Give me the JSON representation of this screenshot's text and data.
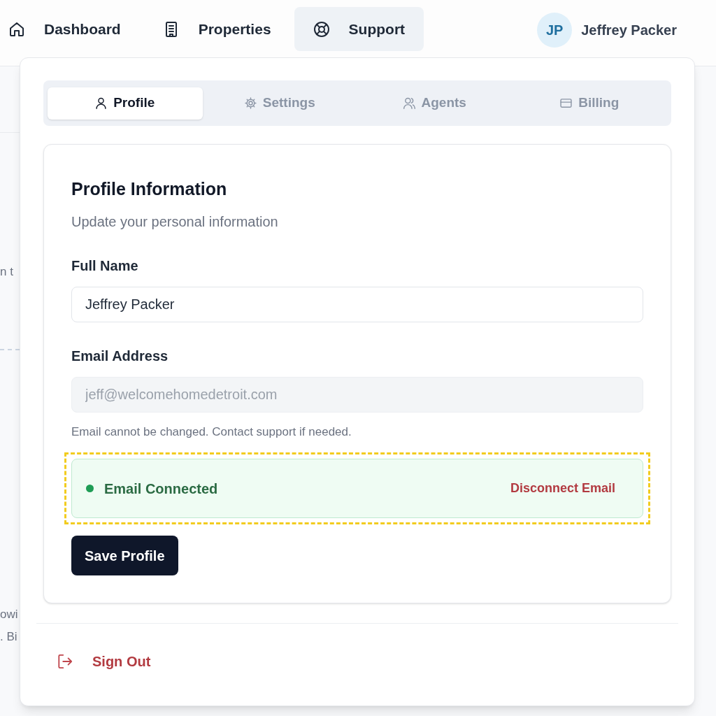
{
  "nav": {
    "items": [
      {
        "label": "Dashboard",
        "selected": false
      },
      {
        "label": "Properties",
        "selected": false
      },
      {
        "label": "Support",
        "selected": true
      }
    ]
  },
  "user": {
    "initials": "JP",
    "name": "Jeffrey Packer"
  },
  "background_text": [
    "n t",
    "owi",
    ". Bi"
  ],
  "panel": {
    "tabs": [
      {
        "label": "Profile",
        "selected": true
      },
      {
        "label": "Settings",
        "selected": false
      },
      {
        "label": "Agents",
        "selected": false
      },
      {
        "label": "Billing",
        "selected": false
      }
    ],
    "card": {
      "title": "Profile Information",
      "subtitle": "Update your personal information",
      "fields": [
        {
          "label": "Full Name",
          "value": "Jeffrey Packer",
          "disabled": false
        },
        {
          "label": "Email Address",
          "value": "jeff@welcomehomedetroit.com",
          "disabled": true,
          "hint": "Email cannot be changed. Contact support if needed."
        }
      ],
      "email_status": {
        "label": "Email Connected",
        "connected": true,
        "highlighted": true,
        "action": "Disconnect Email"
      },
      "save_button": "Save Profile"
    },
    "sign_out": "Sign Out"
  }
}
